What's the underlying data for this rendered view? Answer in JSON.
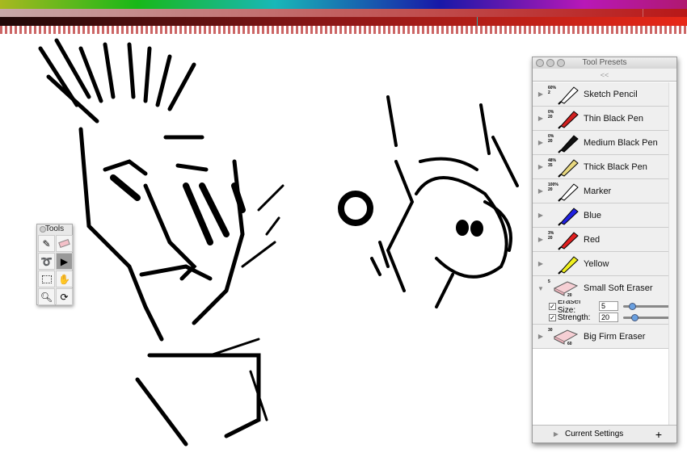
{
  "tools_palette": {
    "title": "Tools",
    "tools": [
      "pencil",
      "eraser",
      "lasso",
      "select-arrow",
      "marquee",
      "hand",
      "zoom",
      "rotate"
    ],
    "selected": "select-arrow"
  },
  "tool_presets": {
    "title": "Tool Presets",
    "collapse_label": "<<",
    "items": [
      {
        "label": "Sketch Pencil",
        "opacity": "60%",
        "size": "2",
        "color": "#ffffff"
      },
      {
        "label": "Thin Black Pen",
        "opacity": "0%",
        "size": "20",
        "color": "#d02020"
      },
      {
        "label": "Medium Black Pen",
        "opacity": "0%",
        "size": "20",
        "color": "#111111"
      },
      {
        "label": "Thick Black Pen",
        "opacity": "48%",
        "size": "35",
        "color": "#e8d880"
      },
      {
        "label": "Marker",
        "opacity": "100%",
        "size": "20",
        "color": "#ffffff"
      },
      {
        "label": "Blue",
        "opacity": "",
        "size": "",
        "color": "#2020e0"
      },
      {
        "label": "Red",
        "opacity": "3%",
        "size": "20",
        "color": "#e02020"
      },
      {
        "label": "Yellow",
        "opacity": "",
        "size": "",
        "color": "#f0f020"
      }
    ],
    "expanded": {
      "label": "Small Soft Eraser",
      "top": "5",
      "bottom": "20",
      "eraser_size_label": "Eraser Size:",
      "eraser_size": "5",
      "eraser_size_level": 0.15,
      "strength_label": "Strength:",
      "strength": "20",
      "strength_level": 0.2
    },
    "last": {
      "label": "Big Firm Eraser",
      "top": "30",
      "bottom": "60"
    },
    "footer": {
      "label": "Current Settings",
      "add": "+"
    }
  }
}
